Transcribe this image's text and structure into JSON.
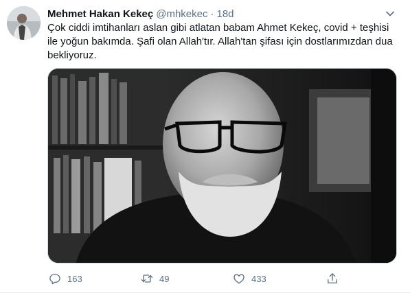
{
  "tweet": {
    "author_name": "Mehmet Hakan Kekeç",
    "handle": "@mhkekec",
    "separator": "·",
    "time": "18d",
    "text": "Çok ciddi imtihanları aslan gibi atlatan babam Ahmet Kekeç, covid + teşhisi\nile yoğun bakımda. Şafi olan Allah'tır. Allah'tan şifası için dostlarımızdan dua\nbekliyoruz."
  },
  "actions": {
    "replies": "163",
    "retweets": "49",
    "likes": "433"
  },
  "icons": {
    "more": "chevron-down-icon",
    "reply": "reply-icon",
    "retweet": "retweet-icon",
    "like": "heart-icon",
    "share": "share-icon"
  },
  "colors": {
    "text": "#0f1419",
    "secondary": "#5b7083",
    "border": "#e6ecf0"
  }
}
